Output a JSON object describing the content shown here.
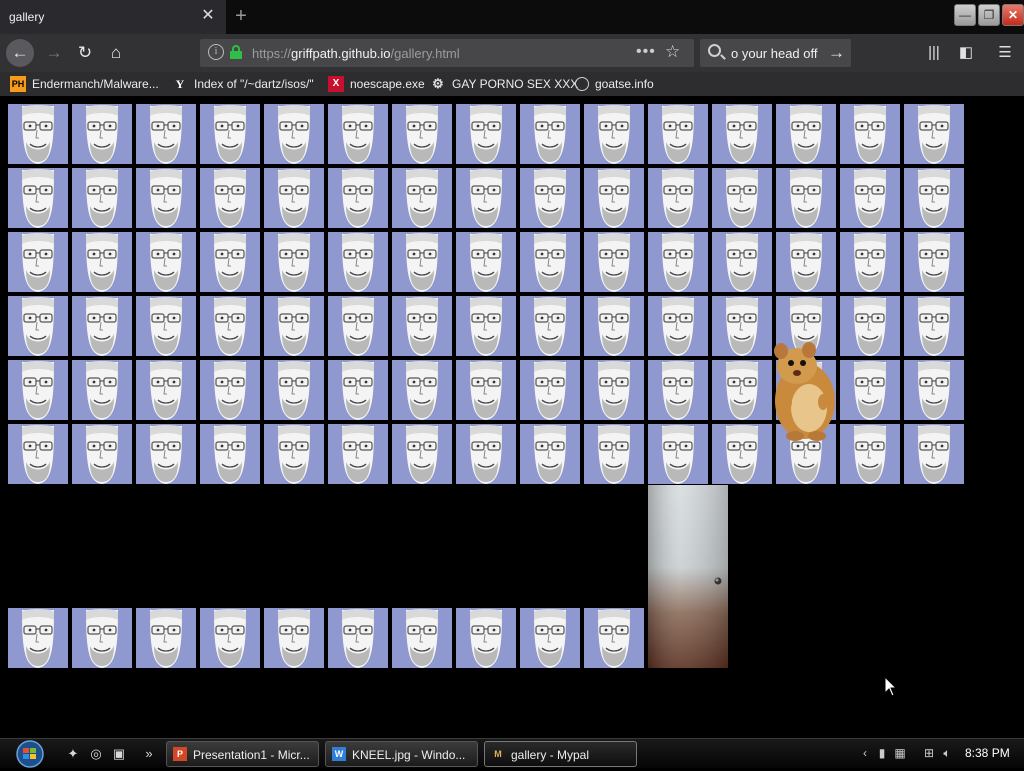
{
  "tab": {
    "title": "gallery",
    "close_label": "✕",
    "new_tab_label": "+"
  },
  "window_controls": {
    "minimize": "—",
    "restore": "❐",
    "close": "✕"
  },
  "nav": {
    "url_prefix": "https://",
    "url_host": "griffpath.github.io",
    "url_path": "/gallery.html",
    "search_value": "o your head off",
    "more_label": "•••"
  },
  "bookmarks": [
    {
      "label": "Endermanch/Malware...",
      "icon": "PH"
    },
    {
      "label": "Index of \"/~dartz/isos/\"",
      "icon": "Y"
    },
    {
      "label": "noescape.exe",
      "icon": "X"
    },
    {
      "label": "GAY PORNO SEX XXX",
      "icon": "gear-icon"
    },
    {
      "label": "goatse.info",
      "icon": "globe-icon"
    }
  ],
  "gallery": {
    "columns": 15,
    "full_rows": 6,
    "bottom_row_count": 10,
    "face_bg": "#8f99cf"
  },
  "taskbar": {
    "buttons": [
      {
        "label": "Presentation1 - Micr...",
        "icon": "P"
      },
      {
        "label": "KNEEL.jpg - Windo...",
        "icon": "W"
      },
      {
        "label": "gallery - Mypal",
        "icon": "M"
      }
    ],
    "clock": "8:38 PM",
    "tray_expand": "‹"
  }
}
